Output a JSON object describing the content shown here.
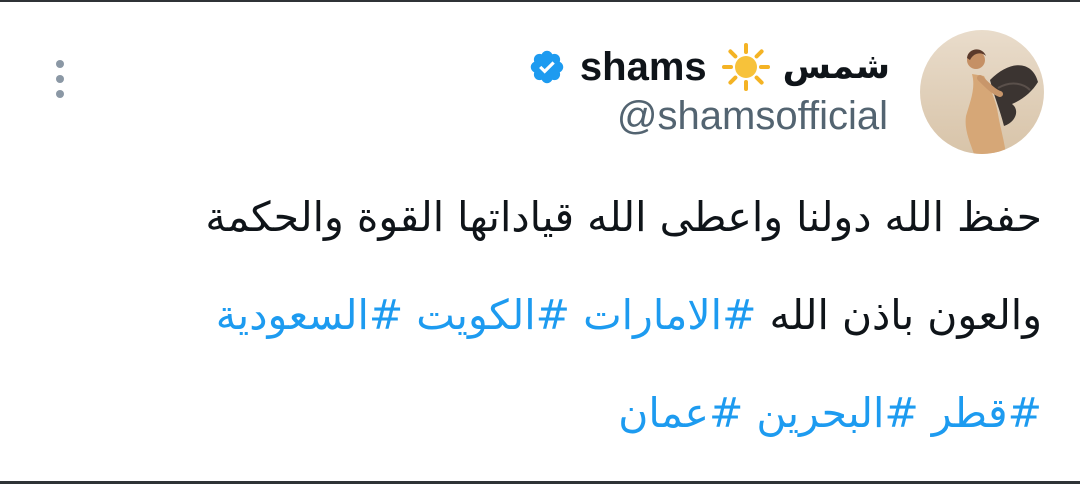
{
  "author": {
    "display_name_latin": "shams",
    "display_name_arabic": "شمس",
    "handle": "@shamsofficial",
    "verified_icon": "verified-badge-icon",
    "emoji_icon": "sun-emoji-icon",
    "avatar": "profile-photo"
  },
  "tweet": {
    "line1": "حفظ الله دولنا واعطى الله قياداتها القوة والحكمة",
    "line2_text": "والعون باذن الله ",
    "hashtags": [
      "#الامارات",
      "#الكويت",
      "#السعودية",
      "#قطر",
      "#البحرين",
      "#عمان"
    ]
  },
  "menu": {
    "icon": "more-vertical-icon"
  },
  "colors": {
    "text": "#0f1419",
    "secondary": "#536471",
    "link": "#1d9bf0",
    "verified": "#1d9bf0",
    "sun": "#f4b324"
  }
}
